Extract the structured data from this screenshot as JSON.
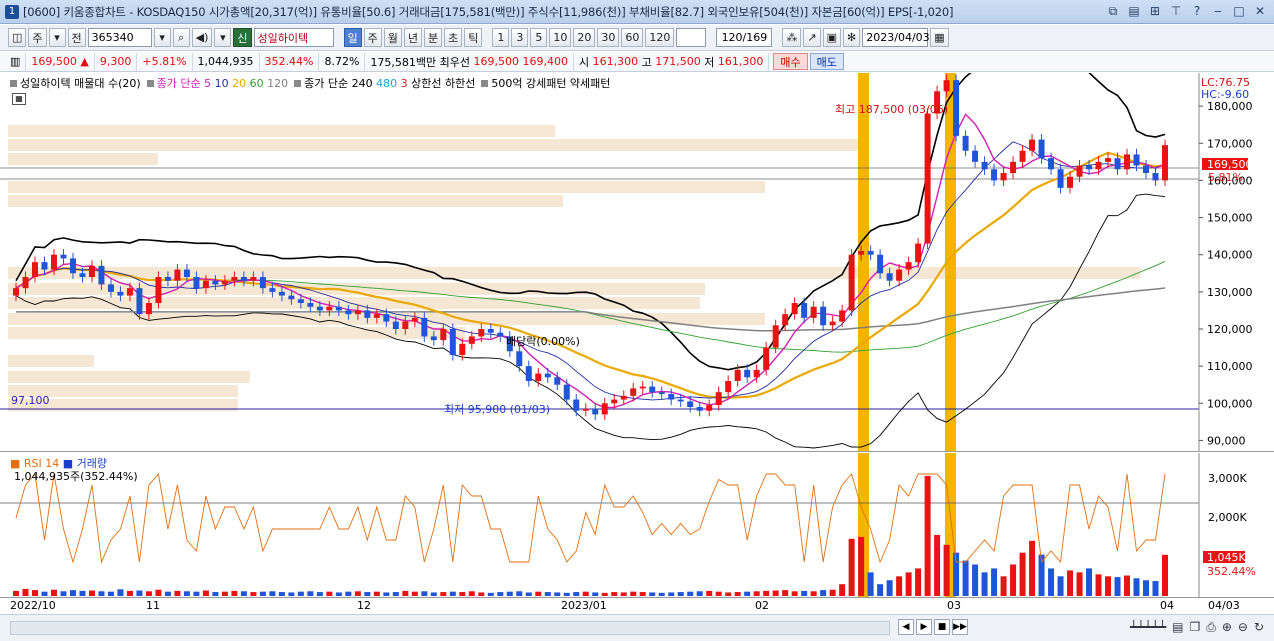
{
  "window": {
    "number": "1",
    "title": "[0600] 키움종합차트 - KOSDAQ150 시가총액[20,317(억)] 유통비율[50.6] 거래대금[175,581(백만)] 주식수[11,986(천)] 부채비율[82.7] 외국인보유[504(천)] 자본금[60(억)] EPS[-1,020]"
  },
  "toolbar": {
    "type_label": "주",
    "prev_label": "전",
    "stock_code": "365340",
    "sin_label": "신",
    "stock_name": "성일하이텍",
    "period_buttons": [
      "일",
      "주",
      "월",
      "년",
      "분",
      "초",
      "틱"
    ],
    "interval_buttons": [
      "1",
      "3",
      "5",
      "10",
      "20",
      "30",
      "60",
      "120"
    ],
    "count_display": "120/169",
    "date_value": "2023/04/03"
  },
  "quote": {
    "price": "169,500",
    "change": "9,300",
    "change_pct": "+5.81%",
    "volume": "1,044,935",
    "vol_ratio": "352.44%",
    "turnover": "8.72%",
    "amount": "175,581백만",
    "best_label": "최우선",
    "best_ask": "169,500",
    "best_bid": "169,400",
    "open_label": "시",
    "open": "161,300",
    "high_label": "고",
    "high": "171,500",
    "low_label": "저",
    "low": "161,300",
    "buy_label": "매수",
    "sell_label": "매도"
  },
  "legend": {
    "profile": "성일하이텍 매물대 수(20)",
    "ma_price_label": "종가 단순",
    "ma_periods": [
      "5",
      "10",
      "20",
      "60",
      "120"
    ],
    "ma_long_label": "종가 단순",
    "ma_long_periods": [
      "240",
      "480",
      "3"
    ],
    "limit_labels": "상한선 하한선",
    "pattern_label": "500억 강세패턴 약세패턴"
  },
  "annotations": {
    "high": "최고 187,500 (03/06)",
    "low": "최저 95,900 (01/03)",
    "dividend": "배당락(0.00%)",
    "line_value": "97,100",
    "lc": "LC:76.75",
    "hc": "HC:-9.60",
    "current_price_tag": "169,500",
    "current_pct_tag": "5.81%",
    "vol_tag": "1,045K",
    "vol_pct_tag": "352.44%"
  },
  "sub": {
    "rsi_label": "RSI 14",
    "volume_label": "거래량",
    "volume_readout": "1,044,935주(352.44%)"
  },
  "xaxis": [
    "2022/10",
    "11",
    "12",
    "2023/01",
    "02",
    "03",
    "04",
    "04/03"
  ],
  "colors": {
    "up": "#e81414",
    "down": "#1f55d6",
    "ma5": "#d21fb4",
    "ma10": "#1f2fa5",
    "ma20": "#eaa800",
    "ma60": "#30a030",
    "ma120": "#808080",
    "envelope": "#000000",
    "highlight": "#f2b500"
  },
  "chart_data": {
    "type": "candlestick",
    "y_axis_labels": [
      "180,000",
      "170,000",
      "160,000",
      "150,000",
      "140,000",
      "130,000",
      "120,000",
      "110,000",
      "100,000",
      "90,000"
    ],
    "ylim": [
      85000,
      190000
    ],
    "volume_axis_labels": [
      "3,000K",
      "2,000K"
    ],
    "x_labels": [
      "2022/10",
      "11",
      "12",
      "2023/01",
      "02",
      "03",
      "04"
    ],
    "closes": [
      131000,
      134000,
      138000,
      136000,
      140000,
      139000,
      135000,
      134000,
      137000,
      132000,
      130000,
      129000,
      131000,
      124000,
      127000,
      134000,
      133000,
      136000,
      134000,
      131000,
      133000,
      132000,
      133000,
      134000,
      133000,
      134000,
      131000,
      130000,
      129000,
      128000,
      127000,
      126000,
      125000,
      126000,
      125000,
      124000,
      125000,
      123000,
      124000,
      122000,
      120000,
      122000,
      123000,
      118000,
      117000,
      120000,
      113000,
      116000,
      118000,
      120000,
      119000,
      118000,
      114000,
      110000,
      106000,
      108000,
      107000,
      105000,
      101000,
      98000,
      98500,
      97000,
      100000,
      101000,
      102000,
      104000,
      104500,
      103000,
      102500,
      101000,
      100500,
      99000,
      98000,
      99500,
      103000,
      106000,
      109000,
      107000,
      109000,
      115000,
      121000,
      124000,
      127000,
      123000,
      126000,
      121000,
      122000,
      125000,
      140000,
      141000,
      140000,
      135000,
      133000,
      136000,
      138000,
      143000,
      178000,
      184000,
      187000,
      172000,
      168000,
      165000,
      163000,
      160000,
      162000,
      165000,
      168000,
      171000,
      166000,
      163000,
      158000,
      161000,
      164000,
      163000,
      165000,
      166000,
      163000,
      167000,
      164000,
      162000,
      160000,
      169500
    ],
    "volumes_k": [
      130,
      180,
      150,
      110,
      160,
      120,
      150,
      130,
      140,
      120,
      110,
      170,
      130,
      140,
      120,
      160,
      110,
      130,
      120,
      110,
      140,
      100,
      110,
      130,
      120,
      100,
      110,
      120,
      100,
      90,
      110,
      120,
      100,
      110,
      90,
      110,
      120,
      100,
      110,
      90,
      100,
      130,
      110,
      120,
      90,
      100,
      110,
      100,
      120,
      90,
      80,
      100,
      110,
      120,
      90,
      110,
      100,
      90,
      80,
      100,
      110,
      90,
      80,
      100,
      90,
      110,
      100,
      90,
      80,
      90,
      100,
      110,
      120,
      130,
      110,
      90,
      100,
      110,
      120,
      130,
      140,
      150,
      120,
      130,
      120,
      150,
      160,
      300,
      1450,
      1500,
      600,
      300,
      400,
      500,
      600,
      700,
      3050,
      1550,
      1300,
      1100,
      900,
      800,
      600,
      700,
      500,
      800,
      1100,
      1400,
      1050,
      700,
      500,
      650,
      600,
      700,
      550,
      500,
      480,
      520,
      450,
      400,
      380,
      1045
    ]
  }
}
